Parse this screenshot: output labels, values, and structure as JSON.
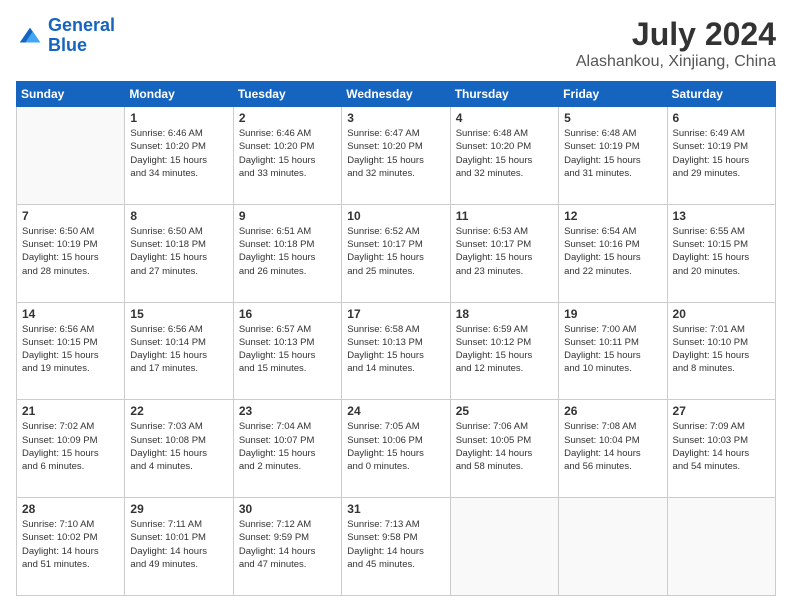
{
  "header": {
    "logo_line1": "General",
    "logo_line2": "Blue",
    "month": "July 2024",
    "location": "Alashankou, Xinjiang, China"
  },
  "days_of_week": [
    "Sunday",
    "Monday",
    "Tuesday",
    "Wednesday",
    "Thursday",
    "Friday",
    "Saturday"
  ],
  "weeks": [
    [
      {
        "day": "",
        "info": ""
      },
      {
        "day": "1",
        "info": "Sunrise: 6:46 AM\nSunset: 10:20 PM\nDaylight: 15 hours\nand 34 minutes."
      },
      {
        "day": "2",
        "info": "Sunrise: 6:46 AM\nSunset: 10:20 PM\nDaylight: 15 hours\nand 33 minutes."
      },
      {
        "day": "3",
        "info": "Sunrise: 6:47 AM\nSunset: 10:20 PM\nDaylight: 15 hours\nand 32 minutes."
      },
      {
        "day": "4",
        "info": "Sunrise: 6:48 AM\nSunset: 10:20 PM\nDaylight: 15 hours\nand 32 minutes."
      },
      {
        "day": "5",
        "info": "Sunrise: 6:48 AM\nSunset: 10:19 PM\nDaylight: 15 hours\nand 31 minutes."
      },
      {
        "day": "6",
        "info": "Sunrise: 6:49 AM\nSunset: 10:19 PM\nDaylight: 15 hours\nand 29 minutes."
      }
    ],
    [
      {
        "day": "7",
        "info": "Sunrise: 6:50 AM\nSunset: 10:19 PM\nDaylight: 15 hours\nand 28 minutes."
      },
      {
        "day": "8",
        "info": "Sunrise: 6:50 AM\nSunset: 10:18 PM\nDaylight: 15 hours\nand 27 minutes."
      },
      {
        "day": "9",
        "info": "Sunrise: 6:51 AM\nSunset: 10:18 PM\nDaylight: 15 hours\nand 26 minutes."
      },
      {
        "day": "10",
        "info": "Sunrise: 6:52 AM\nSunset: 10:17 PM\nDaylight: 15 hours\nand 25 minutes."
      },
      {
        "day": "11",
        "info": "Sunrise: 6:53 AM\nSunset: 10:17 PM\nDaylight: 15 hours\nand 23 minutes."
      },
      {
        "day": "12",
        "info": "Sunrise: 6:54 AM\nSunset: 10:16 PM\nDaylight: 15 hours\nand 22 minutes."
      },
      {
        "day": "13",
        "info": "Sunrise: 6:55 AM\nSunset: 10:15 PM\nDaylight: 15 hours\nand 20 minutes."
      }
    ],
    [
      {
        "day": "14",
        "info": "Sunrise: 6:56 AM\nSunset: 10:15 PM\nDaylight: 15 hours\nand 19 minutes."
      },
      {
        "day": "15",
        "info": "Sunrise: 6:56 AM\nSunset: 10:14 PM\nDaylight: 15 hours\nand 17 minutes."
      },
      {
        "day": "16",
        "info": "Sunrise: 6:57 AM\nSunset: 10:13 PM\nDaylight: 15 hours\nand 15 minutes."
      },
      {
        "day": "17",
        "info": "Sunrise: 6:58 AM\nSunset: 10:13 PM\nDaylight: 15 hours\nand 14 minutes."
      },
      {
        "day": "18",
        "info": "Sunrise: 6:59 AM\nSunset: 10:12 PM\nDaylight: 15 hours\nand 12 minutes."
      },
      {
        "day": "19",
        "info": "Sunrise: 7:00 AM\nSunset: 10:11 PM\nDaylight: 15 hours\nand 10 minutes."
      },
      {
        "day": "20",
        "info": "Sunrise: 7:01 AM\nSunset: 10:10 PM\nDaylight: 15 hours\nand 8 minutes."
      }
    ],
    [
      {
        "day": "21",
        "info": "Sunrise: 7:02 AM\nSunset: 10:09 PM\nDaylight: 15 hours\nand 6 minutes."
      },
      {
        "day": "22",
        "info": "Sunrise: 7:03 AM\nSunset: 10:08 PM\nDaylight: 15 hours\nand 4 minutes."
      },
      {
        "day": "23",
        "info": "Sunrise: 7:04 AM\nSunset: 10:07 PM\nDaylight: 15 hours\nand 2 minutes."
      },
      {
        "day": "24",
        "info": "Sunrise: 7:05 AM\nSunset: 10:06 PM\nDaylight: 15 hours\nand 0 minutes."
      },
      {
        "day": "25",
        "info": "Sunrise: 7:06 AM\nSunset: 10:05 PM\nDaylight: 14 hours\nand 58 minutes."
      },
      {
        "day": "26",
        "info": "Sunrise: 7:08 AM\nSunset: 10:04 PM\nDaylight: 14 hours\nand 56 minutes."
      },
      {
        "day": "27",
        "info": "Sunrise: 7:09 AM\nSunset: 10:03 PM\nDaylight: 14 hours\nand 54 minutes."
      }
    ],
    [
      {
        "day": "28",
        "info": "Sunrise: 7:10 AM\nSunset: 10:02 PM\nDaylight: 14 hours\nand 51 minutes."
      },
      {
        "day": "29",
        "info": "Sunrise: 7:11 AM\nSunset: 10:01 PM\nDaylight: 14 hours\nand 49 minutes."
      },
      {
        "day": "30",
        "info": "Sunrise: 7:12 AM\nSunset: 9:59 PM\nDaylight: 14 hours\nand 47 minutes."
      },
      {
        "day": "31",
        "info": "Sunrise: 7:13 AM\nSunset: 9:58 PM\nDaylight: 14 hours\nand 45 minutes."
      },
      {
        "day": "",
        "info": ""
      },
      {
        "day": "",
        "info": ""
      },
      {
        "day": "",
        "info": ""
      }
    ]
  ]
}
